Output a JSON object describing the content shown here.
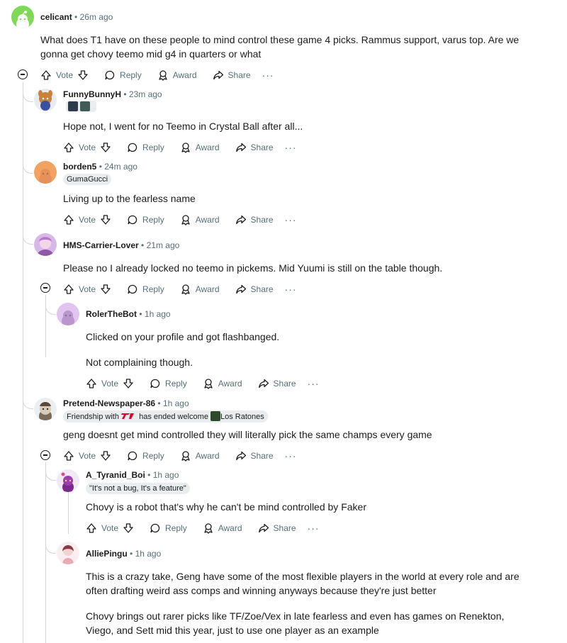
{
  "colors": {
    "text": "#1c1c1c",
    "meta": "#576f76",
    "line": "#d6d6d6",
    "flair_bg": "#eaedef"
  },
  "actions": {
    "vote": "Vote",
    "reply": "Reply",
    "award": "Award",
    "share": "Share",
    "more": "···"
  },
  "comments": [
    {
      "user": "celicant",
      "time": "26m ago",
      "lines": [
        "What does T1 have on these people to mind control these game 4 picks. Rammus support, varus top. Are we",
        "gonna get chovy teemo mid g4 in quarters or what"
      ]
    },
    {
      "user": "FunnyBunnyH",
      "time": "23m ago",
      "lines": [
        "Hope not, I went for no Teemo in Crystal Ball after all..."
      ]
    },
    {
      "user": "borden5",
      "time": "24m ago",
      "flair": "GumaGucci",
      "lines": [
        "Living up to the fearless name"
      ]
    },
    {
      "user": "HMS-Carrier-Lover",
      "time": "21m ago",
      "lines": [
        "Please no I already locked no teemo in pickems. Mid Yuumi is still on the table though."
      ]
    },
    {
      "user": "RolerTheBot",
      "time": "1h ago",
      "lines": [
        "Clicked on your profile and got flashbanged.",
        "Not complaining though."
      ]
    },
    {
      "user": "Pretend-Newspaper-86",
      "time": "1h ago",
      "flair_parts": [
        "Friendship with",
        "has ended welcome",
        "Los Ratones"
      ],
      "lines": [
        "geng doesnt get mind controlled they will literally pick the same champs every game"
      ]
    },
    {
      "user": "A_Tyranid_Boi",
      "time": "1h ago",
      "flair": "\"It's not a bug, It's a feature\"",
      "lines": [
        "Chovy is a robot that's why he can't be mind controlled by Faker"
      ]
    },
    {
      "user": "AlliePingu",
      "time": "1h ago",
      "lines": [
        "This is a crazy take, Geng have some of the most flexible players in the world at every role and are",
        "often drafting weird ass comps and winning anyways because they're just better",
        "Chovy brings out rarer picks like TF/Zoe/Vex in late fearless and even has games on Renekton,",
        "Viego, and Sett mid this year, just to use one player as an example"
      ]
    }
  ]
}
